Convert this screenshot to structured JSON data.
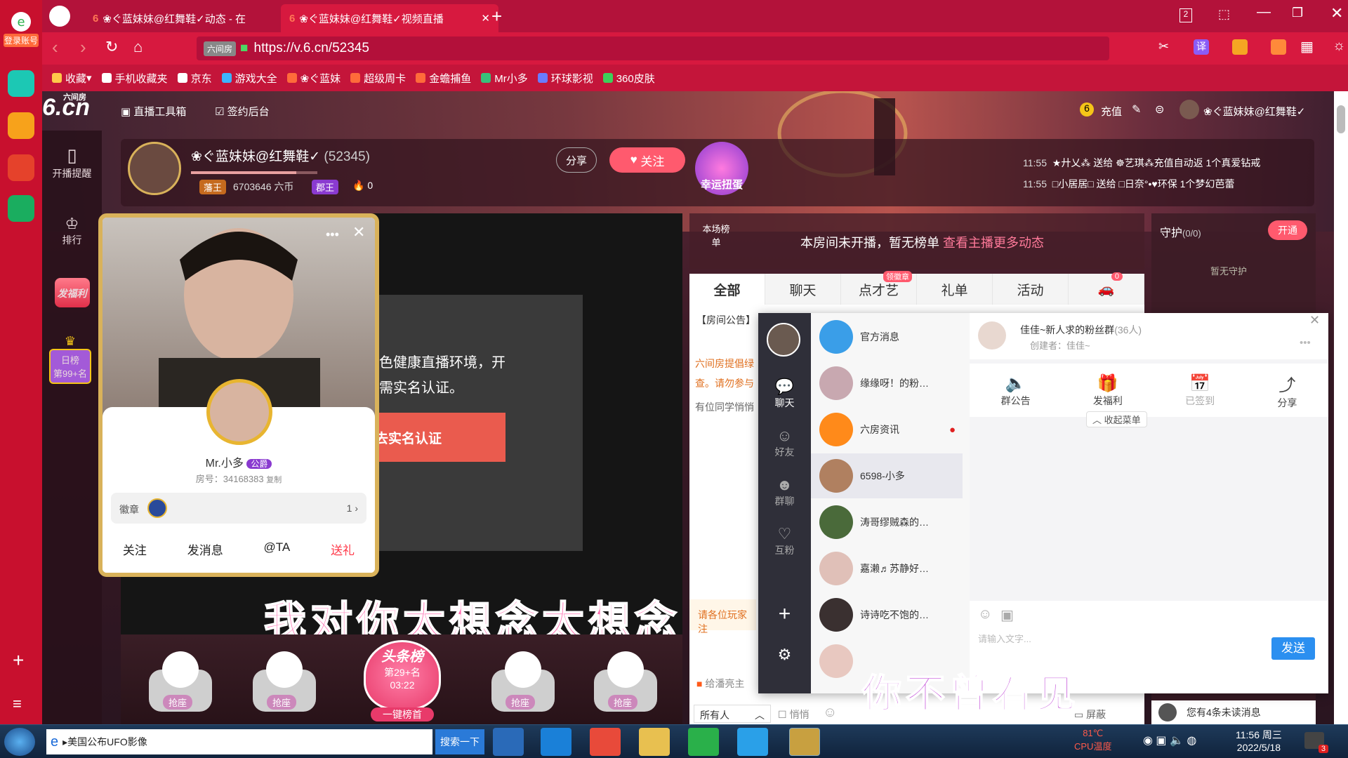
{
  "browser": {
    "left_sidebar": {
      "login_label": "登录账号"
    },
    "tabs": [
      {
        "title": "❀ぐ蓝妹妹@红舞鞋✓动态 - 在"
      },
      {
        "title": "❀ぐ蓝妹妹@红舞鞋✓视频直播"
      }
    ],
    "tab_count": "2",
    "url": "https://v.6.cn/52345",
    "url_badge": "六间房",
    "bookmarks": [
      "收藏",
      "手机收藏夹",
      "京东",
      "游戏大全",
      "❀ぐ蓝妹",
      "超级周卡",
      "金蟾捕鱼",
      "Mr小多",
      "环球影视",
      "360皮肤"
    ],
    "translate_label": "译"
  },
  "site": {
    "logo": "6.cn",
    "logo_sub": "六间房",
    "toolbox": "直播工具箱",
    "signin_admin": "签约后台",
    "recharge": "充值",
    "user_name": "❀ぐ蓝妹妹@红舞鞋✓",
    "left_nav": [
      {
        "label": "开播提醒"
      },
      {
        "label": "排行"
      },
      {
        "label": "发福利"
      }
    ],
    "daily_rank": {
      "label": "日榜",
      "value": "第99+名"
    }
  },
  "room": {
    "host_name": "❀ぐ蓝妹妹@红舞鞋✓",
    "room_id": "(52345)",
    "badge1": "藩王",
    "coins": "6703646 六币",
    "badge2": "郡王",
    "fire_count": "0",
    "share_label": "分享",
    "follow_label": "关注",
    "lucky_label": "幸运扭蛋",
    "gift_feed": [
      {
        "time": "11:55",
        "text": "★廾乂⁂ 送给 ☸艺琪⁂充值自动返 1个真爱钻戒"
      },
      {
        "time": "11:55",
        "text": "□小居居□ 送给 □日奈°•♥环保 1个梦幻芭蕾"
      }
    ]
  },
  "video": {
    "notice_line1": "绿色健康直播环境，开",
    "notice_line2": "播需实名认证。",
    "verify_button": "去实名认证",
    "caption_big": "我对你太想念太想念",
    "caption_small": "你不曾看见"
  },
  "seats": {
    "seat_label": "抢座",
    "headline_title": "头条榜",
    "headline_rank": "第29+名",
    "headline_time": "03:22",
    "headline_button": "一键榜首"
  },
  "rank_panel": {
    "label": "本场榜单",
    "empty_text": "本房间未开播，暂无榜单",
    "link_text": "查看主播更多动态"
  },
  "chat_tabs": [
    {
      "label": "全部"
    },
    {
      "label": "聊天"
    },
    {
      "label": "点才艺",
      "badge": "领徽章"
    },
    {
      "label": "礼单"
    },
    {
      "label": "活动"
    },
    {
      "label": "",
      "badge": "0"
    }
  ],
  "chat": {
    "announcement": "【房间公告】",
    "line1": "六间房提倡绿",
    "line2": "查。请勿参与",
    "line3": "有位同学悄悄",
    "invite": "请各位玩家注",
    "give_host": "给潘亮主",
    "target": "所有人",
    "whisper": "悄悄",
    "block": "屏蔽",
    "fuli": "发福利"
  },
  "guard": {
    "title": "守护",
    "count": "(0/0)",
    "open_button": "开通",
    "empty": "暂无守护",
    "unread": "您有4条未读消息"
  },
  "popup": {
    "name": "Mr.小多",
    "badge": "公爵",
    "room_label": "房号：34168383",
    "copy": "复制",
    "medal_label": "徽章",
    "medal_count": "1",
    "actions": [
      "关注",
      "发消息",
      "@TA",
      "送礼"
    ]
  },
  "im": {
    "side": [
      {
        "label": "聊天"
      },
      {
        "label": "好友"
      },
      {
        "label": "群聊"
      },
      {
        "label": "互粉"
      }
    ],
    "list": [
      {
        "name": "官方消息"
      },
      {
        "name": "缘缘呀！的粉…"
      },
      {
        "name": "六房资讯"
      },
      {
        "name": "6598-小多"
      },
      {
        "name": "涛哥缪贼森的…"
      },
      {
        "name": "嘉濑♬苏静好…"
      },
      {
        "name": "诗诗吃不饱的…"
      }
    ],
    "group_name": "佳佳~新人求的粉丝群",
    "group_count": "(36人)",
    "creator": "创建者：佳佳~",
    "actions": [
      {
        "label": "群公告"
      },
      {
        "label": "发福利"
      },
      {
        "label": "已签到"
      },
      {
        "label": "分享"
      }
    ],
    "collapse": "收起菜单",
    "input_placeholder": "请输入文字...",
    "send": "发送"
  },
  "taskbar": {
    "search_value": "美国公布UFO影像",
    "search_button": "搜索一下",
    "cpu_temp": "81℃",
    "cpu_label": "CPU温度",
    "time": "11:56 周三",
    "date": "2022/5/18",
    "notify_count": "3"
  }
}
